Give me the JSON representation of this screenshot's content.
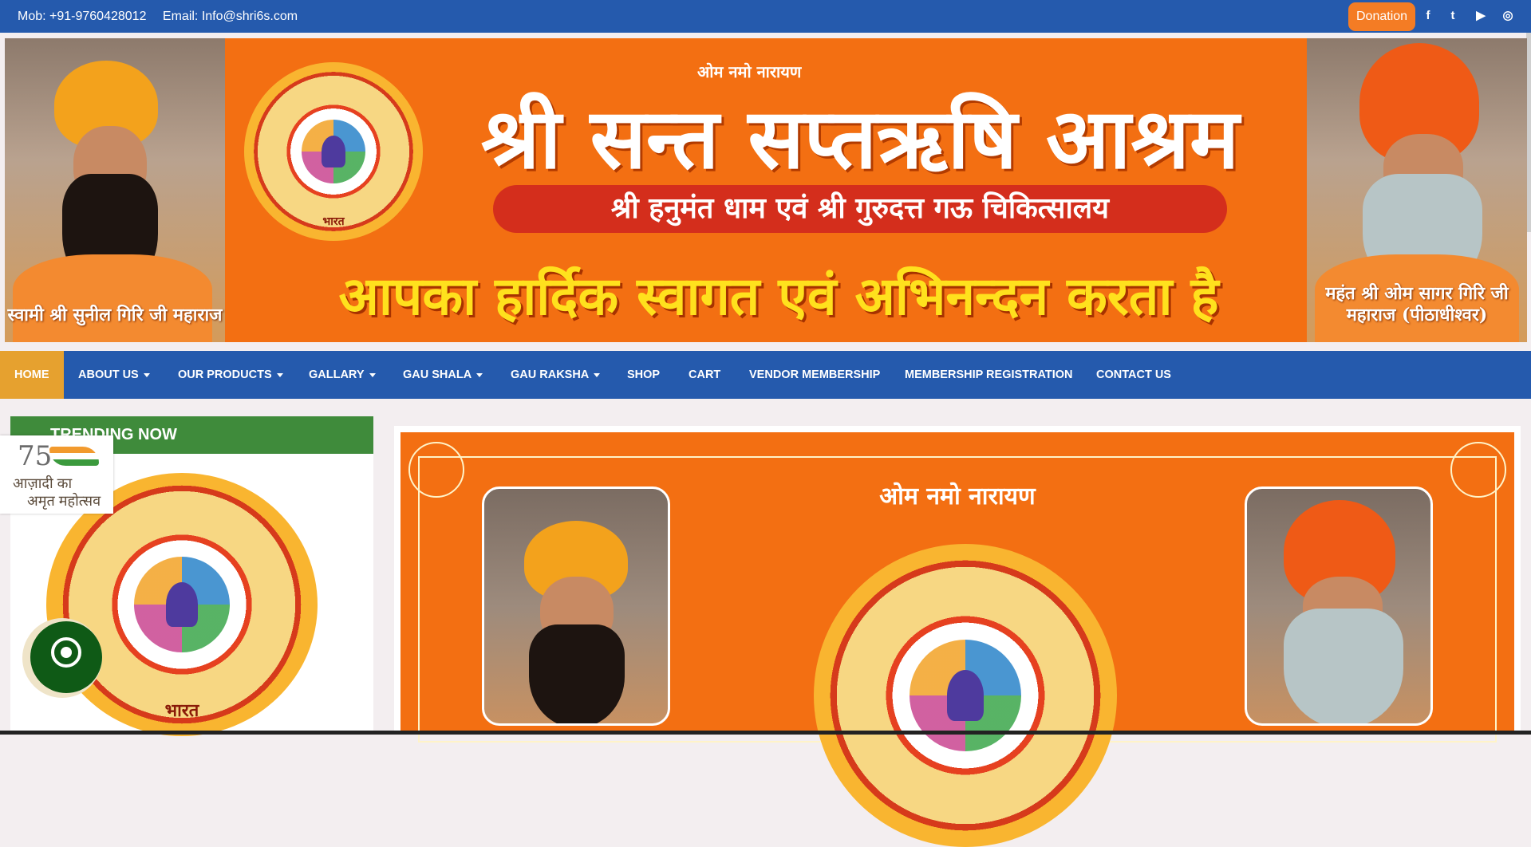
{
  "topbar": {
    "mobile": "Mob: +91-9760428012",
    "email": "Email: Info@shri6s.com",
    "donation": "Donation",
    "social": [
      {
        "icon": "facebook-icon",
        "glyph": "f"
      },
      {
        "icon": "twitter-icon",
        "glyph": "t"
      },
      {
        "icon": "youtube-icon",
        "glyph": "▶"
      },
      {
        "icon": "instagram-icon",
        "glyph": "◎"
      }
    ]
  },
  "banner": {
    "small_heading": "ओम नमो नारायण",
    "title": "श्री सन्त सप्तऋषि आश्रम",
    "subtitle": "श्री हनुमंत धाम एवं श्री गुरुदत्त गऊ चिकित्सालय",
    "welcome": "आपका हार्दिक स्वागत एवं अभिनन्दन करता है",
    "left_caption": "स्वामी श्री सुनील गिरि जी महाराज",
    "right_caption": "महंत श्री ओम सागर गिरि जी महाराज (पीठाधीश्वर)",
    "seal_text": "भारत"
  },
  "nav": {
    "items": [
      {
        "label": "HOME",
        "dropdown": false
      },
      {
        "label": "ABOUT US",
        "dropdown": true
      },
      {
        "label": "OUR PRODUCTS",
        "dropdown": true
      },
      {
        "label": "GALLARY",
        "dropdown": true
      },
      {
        "label": "GAU SHALA",
        "dropdown": true
      },
      {
        "label": "GAU RAKSHA",
        "dropdown": true
      },
      {
        "label": "SHOP",
        "dropdown": false
      },
      {
        "label": "CART",
        "dropdown": false
      },
      {
        "label": "VENDOR MEMBERSHIP",
        "dropdown": false
      },
      {
        "label": "MEMBERSHIP REGISTRATION",
        "dropdown": false
      },
      {
        "label": "CONTACT US",
        "dropdown": false
      }
    ]
  },
  "sidebar": {
    "heading": "TRENDING NOW",
    "seal_text": "भारत"
  },
  "azadi": {
    "number": "75",
    "line1": "आज़ादी का",
    "line2": "अमृत महोत्सव"
  },
  "slider": {
    "small_heading": "ओम नमो नारायण"
  },
  "colors": {
    "nav_blue": "#255aad",
    "active_gold": "#e6a12f",
    "banner_orange": "#f36f12",
    "donate_orange": "#f47c24",
    "trend_green": "#3f8b3b",
    "whatsapp_green": "#0f5a16"
  }
}
